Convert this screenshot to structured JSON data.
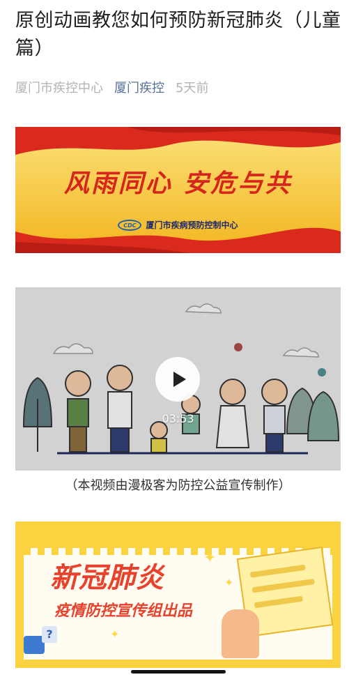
{
  "article": {
    "title": "原创动画教您如何预防新冠肺炎（儿童篇）",
    "author": "厦门市疾控中心",
    "account": "厦门疾控",
    "time": "5天前"
  },
  "banner1": {
    "slogan": "风雨同心  安危与共",
    "logo_text": "CDC",
    "org": "厦门市疾病预防控制中心"
  },
  "video": {
    "duration": "03:53",
    "caption": "（本视频由漫极客为防控公益宣传制作）"
  },
  "banner2": {
    "headline": "新冠肺炎",
    "subtitle": "疫情防控宣传组出品"
  },
  "colors": {
    "accent_red": "#d6261c",
    "banner_yellow": "#f6c832",
    "account_blue": "#56709a"
  }
}
